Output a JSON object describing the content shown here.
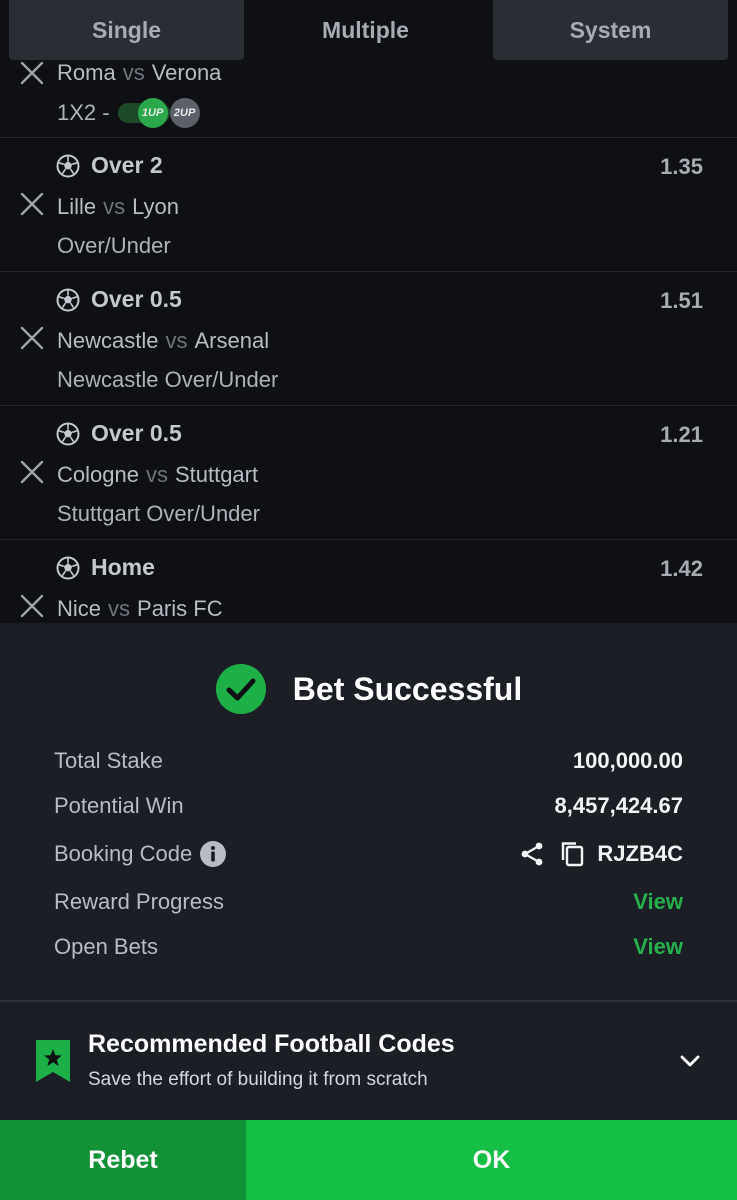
{
  "tabs": [
    {
      "label": "Single",
      "active": false
    },
    {
      "label": "Multiple",
      "active": true
    },
    {
      "label": "System",
      "active": false
    }
  ],
  "bets": [
    {
      "pick": "",
      "odds": "",
      "home": "Roma",
      "vs": "vs",
      "away": "Verona",
      "market": "1X2 -",
      "badges": [
        "1UP",
        "2UP"
      ]
    },
    {
      "pick": "Over 2",
      "odds": "1.35",
      "home": "Lille",
      "vs": "vs",
      "away": "Lyon",
      "market": "Over/Under"
    },
    {
      "pick": "Over 0.5",
      "odds": "1.51",
      "home": "Newcastle",
      "vs": "vs",
      "away": "Arsenal",
      "market": "Newcastle Over/Under"
    },
    {
      "pick": "Over 0.5",
      "odds": "1.21",
      "home": "Cologne",
      "vs": "vs",
      "away": "Stuttgart",
      "market": "Stuttgart Over/Under"
    },
    {
      "pick": "Home",
      "odds": "1.42",
      "home": "Nice",
      "vs": "vs",
      "away": "Paris FC",
      "market": ""
    }
  ],
  "success": {
    "title": "Bet Successful",
    "rows": {
      "total_stake": {
        "label": "Total Stake",
        "value": "100,000.00"
      },
      "potential_win": {
        "label": "Potential Win",
        "value": "8,457,424.67"
      },
      "booking_code": {
        "label": "Booking Code",
        "value": "RJZB4C"
      },
      "reward_progress": {
        "label": "Reward Progress",
        "value": "View"
      },
      "open_bets": {
        "label": "Open Bets",
        "value": "View"
      }
    }
  },
  "recommended": {
    "title": "Recommended Football Codes",
    "subtitle": "Save the effort of building it from scratch"
  },
  "buttons": {
    "rebet": "Rebet",
    "ok": "OK"
  },
  "colors": {
    "accent_green": "#15bf45",
    "dark_green": "#139137",
    "link_green": "#27b14c",
    "panel_bg": "#1b1e25",
    "page_bg": "#0e1014"
  },
  "icons": {
    "remove": "close-icon",
    "sport": "soccer-ball-icon",
    "success": "check-circle-icon",
    "info": "info-icon",
    "share": "share-icon",
    "copy": "copy-icon",
    "bookmark": "bookmark-star-icon",
    "expand": "chevron-down-icon"
  }
}
